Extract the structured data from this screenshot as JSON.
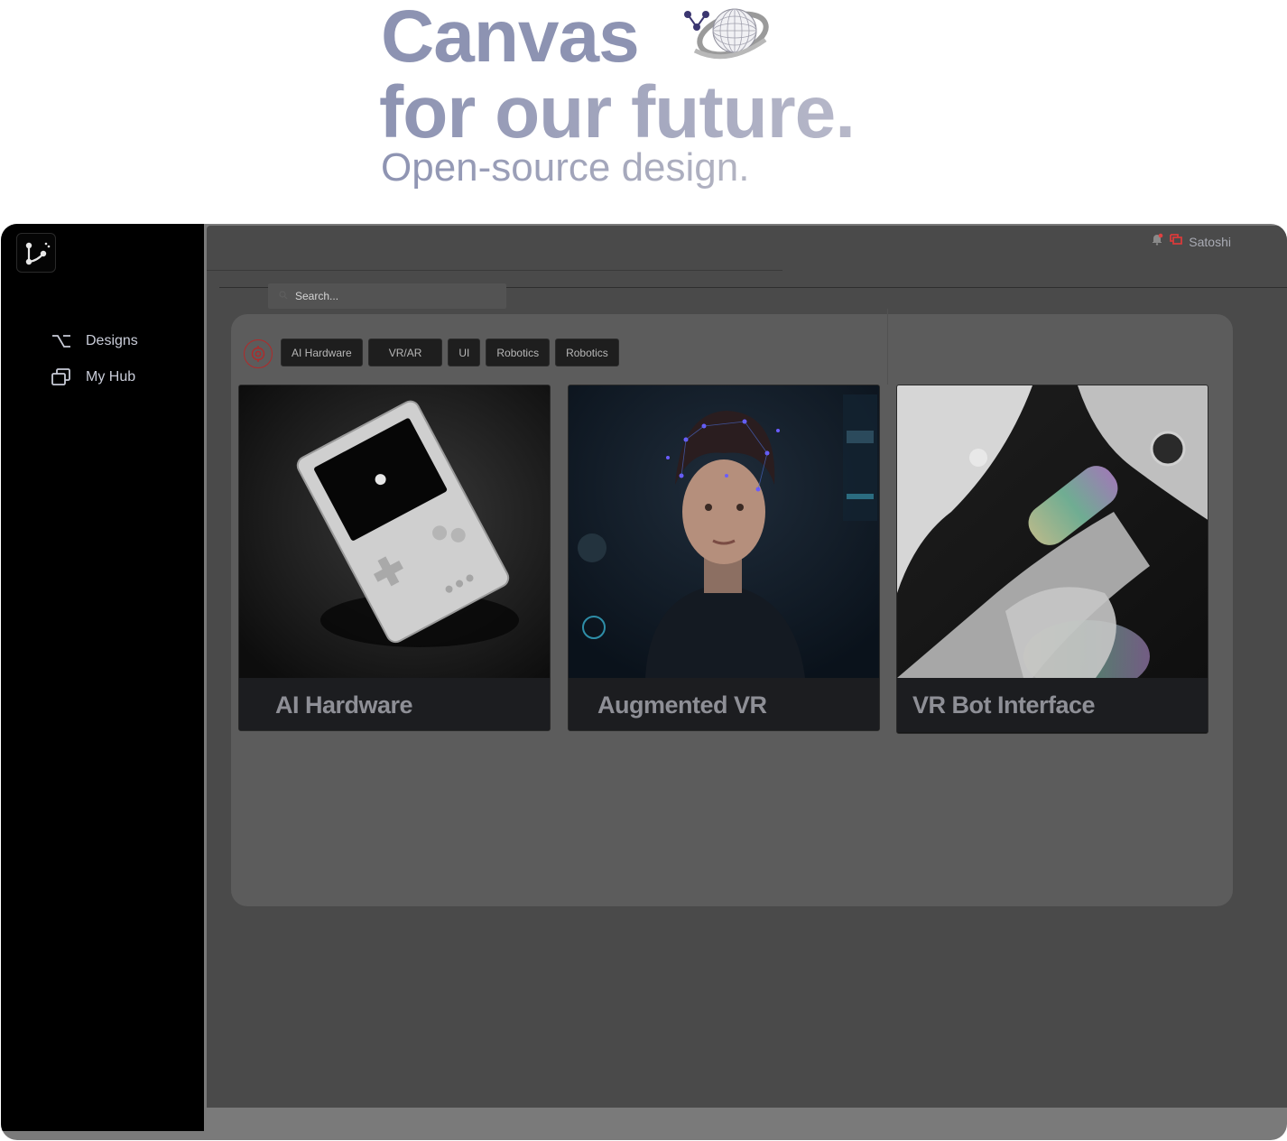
{
  "hero": {
    "line1": "Canvas",
    "line2": "for our future.",
    "line3": "Open-source design."
  },
  "sidebar": {
    "items": [
      {
        "label": "Designs",
        "icon": "option-key-icon"
      },
      {
        "label": "My Hub",
        "icon": "copy-windows-icon"
      }
    ]
  },
  "header": {
    "user_name": "Satoshi",
    "notification_dot_color": "#e04040"
  },
  "search": {
    "placeholder": "Search..."
  },
  "filters": {
    "chips": [
      "AI Hardware",
      "VR/AR",
      "UI",
      "Robotics",
      "Robotics"
    ]
  },
  "cards": [
    {
      "title": "AI Hardware",
      "image": "handheld-console-image"
    },
    {
      "title": "Augmented VR",
      "image": "hologram-portrait-image"
    },
    {
      "title": "VR Bot Interface",
      "image": "robot-arm-image"
    }
  ],
  "colors": {
    "accent_red": "#b02a2a",
    "hero_text": "#8d93b2"
  }
}
